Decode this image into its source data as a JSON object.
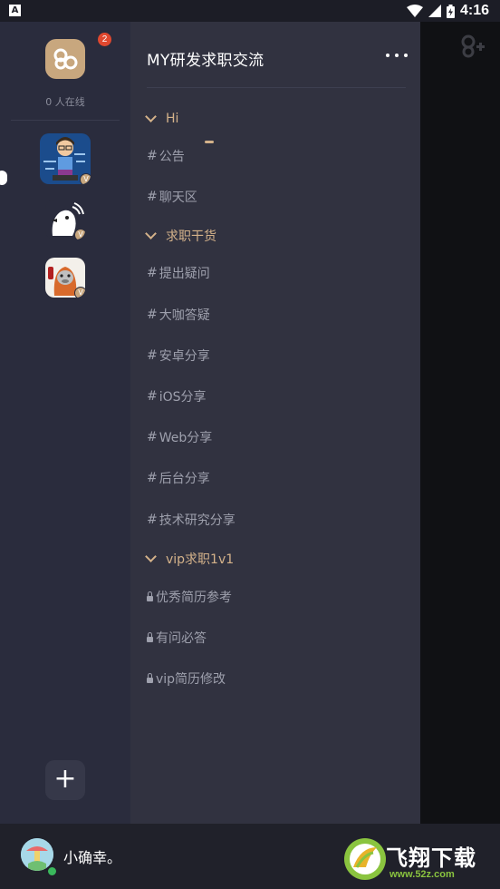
{
  "status_bar": {
    "notification_icon": "A",
    "time": "4:16",
    "icons": [
      "wifi-icon",
      "signal-icon",
      "battery-icon"
    ]
  },
  "guild_rail": {
    "unread_badge": "2",
    "online_count": "0 人在线",
    "guilds": [
      {
        "name": "guild-avatar-coder",
        "verified": "V"
      },
      {
        "name": "guild-avatar-bird",
        "verified": "V"
      },
      {
        "name": "guild-avatar-seal",
        "verified": "V"
      }
    ],
    "add_label": "+"
  },
  "channel_list": {
    "title": "MY研发求职交流",
    "more_label": "•••",
    "categories": [
      {
        "label": "Hi",
        "channels": [
          {
            "prefix": "#",
            "label": "公告"
          },
          {
            "prefix": "#",
            "label": "聊天区"
          }
        ]
      },
      {
        "label": "求职干货",
        "channels": [
          {
            "prefix": "#",
            "label": "提出疑问"
          },
          {
            "prefix": "#",
            "label": "大咖答疑"
          },
          {
            "prefix": "#",
            "label": "安卓分享"
          },
          {
            "prefix": "#",
            "label": "iOS分享"
          },
          {
            "prefix": "#",
            "label": "Web分享"
          },
          {
            "prefix": "#",
            "label": "后台分享"
          },
          {
            "prefix": "#",
            "label": "技术研究分享"
          }
        ]
      },
      {
        "label": "vip求职1v1",
        "channels": [
          {
            "prefix": "lock",
            "label": "优秀简历参考"
          },
          {
            "prefix": "lock",
            "label": "有问必答"
          },
          {
            "prefix": "lock",
            "label": "vip简历修改"
          }
        ]
      }
    ]
  },
  "footer": {
    "username": "小确幸。",
    "watermark_main": "飞翔下载",
    "watermark_sub": "www.52z.com"
  },
  "colors": {
    "accent": "#d4b28a",
    "rail_bg": "#2a2c3d",
    "channels_bg": "#313240",
    "badge": "#e0482f",
    "online": "#3ab85c"
  }
}
